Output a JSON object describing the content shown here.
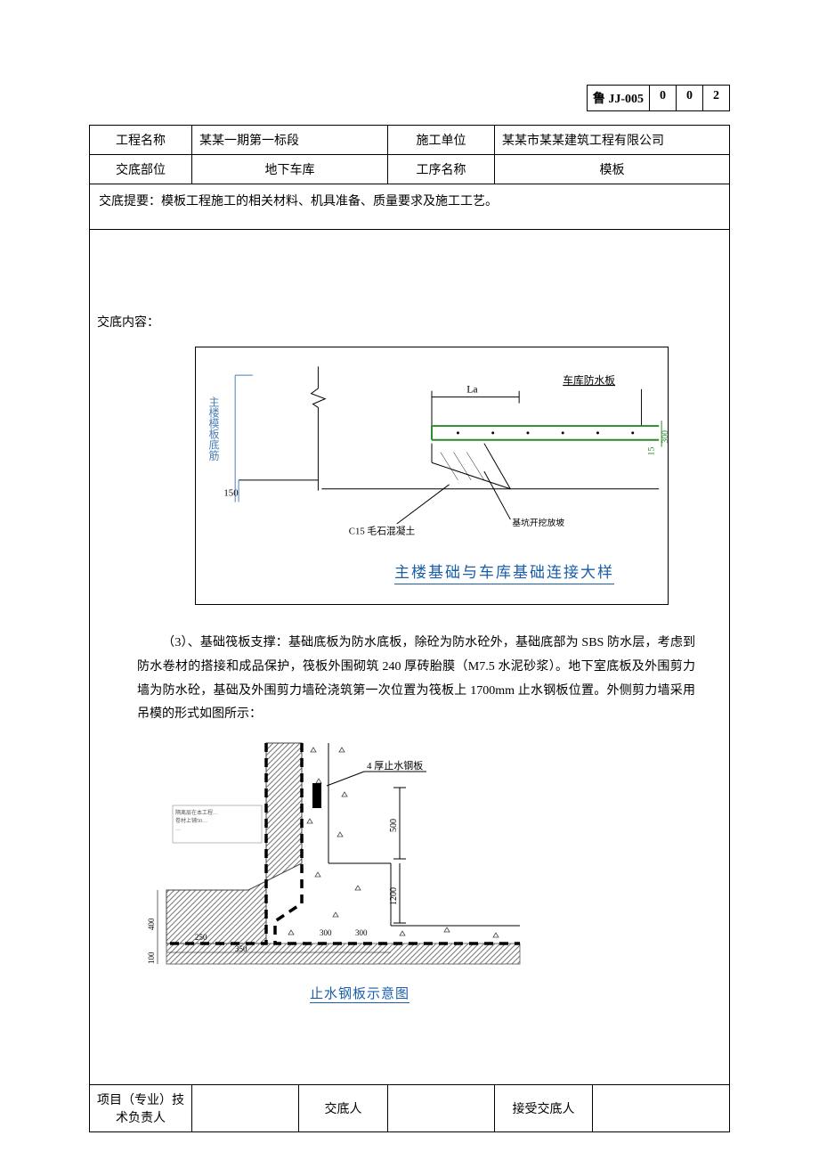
{
  "docCode": {
    "label": "鲁 JJ-005",
    "c1": "0",
    "c2": "0",
    "c3": "2"
  },
  "header": {
    "projNameLabel": "工程名称",
    "projName": "某某一期第一标段",
    "constructorLabel": "施工单位",
    "constructor": "某某市某某建筑工程有限公司",
    "partLabel": "交底部位",
    "part": "地下车库",
    "processLabel": "工序名称",
    "process": "模板"
  },
  "summaryLabel": "交底提要：",
  "summary": "模板工程施工的相关材料、机具准备、质量要求及施工工艺。",
  "contentLabel": "交底内容：",
  "fig1": {
    "leftV": "主楼模板底筋",
    "dim150": "150",
    "La": "La",
    "garageWP": "车库防水板",
    "dim300": "300",
    "dim150r": "15",
    "c15": "C15 毛石混凝土",
    "note": "基坑开挖放坡",
    "caption": "主楼基础与车库基础连接大样"
  },
  "para": {
    "lead": "（3）、基础筏板支撑：",
    "text": "基础底板为防水底板，除砼为防水砼外，基础底部为 SBS 防水层，考虑到防水卷材的搭接和成品保护，筏板外围砌筑 240 厚砖胎膜（M7.5 水泥砂浆）。地下室底板及外围剪力墙为防水砼，基础及外围剪力墙砼浇筑第一次位置为筏板上 1700mm 止水钢板位置。外侧剪力墙采用吊模的形式如图所示："
  },
  "fig2": {
    "steelplate": "4 厚止水钢板",
    "d500": "500",
    "d1200": "1200",
    "d300a": "300",
    "d250": "250",
    "d350": "350",
    "d300b": "300",
    "d400": "400",
    "d100": "100",
    "caption": "止水钢板示意图"
  },
  "footer": {
    "f1": "项目（专业）技术负责人",
    "f2": "交底人",
    "f3": "接受交底人"
  }
}
